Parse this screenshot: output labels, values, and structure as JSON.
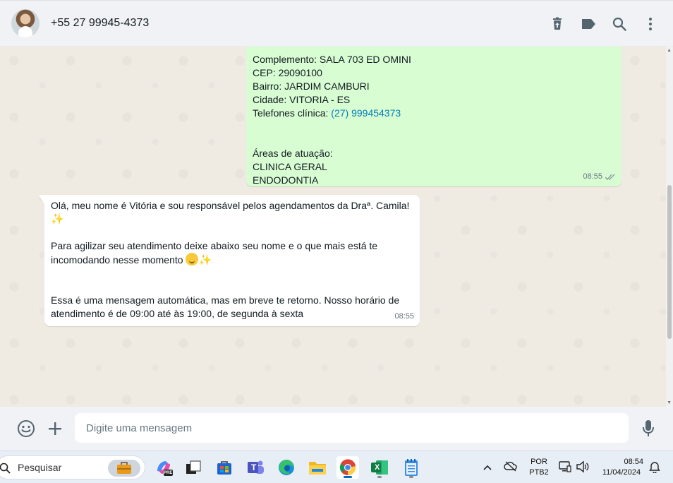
{
  "header": {
    "contact_name": "+55 27 99945-4373"
  },
  "messages": {
    "outgoing": {
      "lines": [
        "Complemento: SALA 703 ED OMINI",
        "CEP: 29090100",
        "Bairro: JARDIM CAMBURI",
        "Cidade: VITORIA - ES"
      ],
      "phone_label": "Telefones clínica: ",
      "phone_link": "(27) 999454373",
      "areas_label": "Áreas de atuação:",
      "areas": [
        "CLINICA GERAL",
        "ENDODONTIA"
      ],
      "time": "08:55"
    },
    "incoming": {
      "line1": "Olá, meu nome é Vitória e sou responsável pelos agendamentos da Draª. Camila!",
      "line2a": " Para agilizar seu atendimento deixe abaixo seu nome e o que mais está te",
      "line2b": "incomodando nesse momento",
      "line3a": "Essa é uma mensagem automática, mas em breve te retorno. Nosso horário de",
      "line3b": "atendimento é de 09:00 até às 19:00, de segunda à sexta",
      "time": "08:55"
    }
  },
  "composer": {
    "placeholder": "Digite uma mensagem"
  },
  "taskbar": {
    "search_label": "Pesquisar",
    "lang_line1": "POR",
    "lang_line2": "PTB2",
    "clock_time": "08:54",
    "clock_date": "11/04/2024",
    "pre_badge": "PRE",
    "teams_letter": "T",
    "excel_letter": "X"
  },
  "colors": {
    "outgoing_bubble": "#d9fdd3",
    "incoming_bubble": "#ffffff",
    "link": "#027eb5",
    "icon": "#54656f"
  }
}
